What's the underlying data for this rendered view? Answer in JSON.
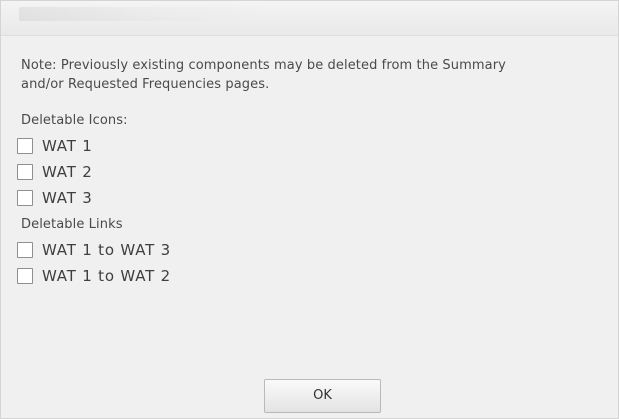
{
  "dialog": {
    "note": "Note: Previously existing components may be deleted from the Summary and/or Requested Frequencies pages.",
    "icons_label": "Deletable Icons:",
    "icons": [
      {
        "label": "WAT 1",
        "checked": false
      },
      {
        "label": "WAT 2",
        "checked": false
      },
      {
        "label": "WAT 3",
        "checked": false
      }
    ],
    "links_label": "Deletable Links",
    "links": [
      {
        "label": "WAT 1 to WAT 3",
        "checked": false
      },
      {
        "label": "WAT 1 to WAT 2",
        "checked": false
      }
    ],
    "ok_label": "OK"
  }
}
